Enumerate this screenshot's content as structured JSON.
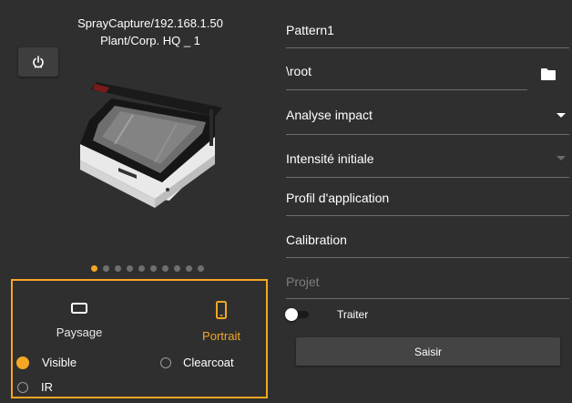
{
  "device": {
    "name": "SprayCapture/192.168.1.50",
    "location": "Plant/Corp. HQ _ 1",
    "power_icon": "power-icon"
  },
  "carousel": {
    "count": 10,
    "active_index": 0
  },
  "orientation": {
    "options": [
      {
        "label": "Paysage",
        "icon": "landscape-icon",
        "selected": false
      },
      {
        "label": "Portrait",
        "icon": "portrait-icon",
        "selected": true
      }
    ]
  },
  "light_mode": {
    "options": [
      {
        "label": "Visible",
        "checked": true
      },
      {
        "label": "Clearcoat",
        "checked": false
      },
      {
        "label": "IR",
        "checked": false
      }
    ]
  },
  "form": {
    "pattern": "Pattern1",
    "path": "\\root",
    "path_icon": "folder-icon",
    "analysis_select": "Analyse impact",
    "intensity_select": "Intensité initiale",
    "profile": "Profil d'application",
    "calibration": "Calibration",
    "project_placeholder": "Projet",
    "process_toggle_label": "Traiter",
    "process_toggle_on": false,
    "submit_label": "Saisir"
  },
  "colors": {
    "accent": "#f5a623",
    "background": "#2f2f2f"
  }
}
